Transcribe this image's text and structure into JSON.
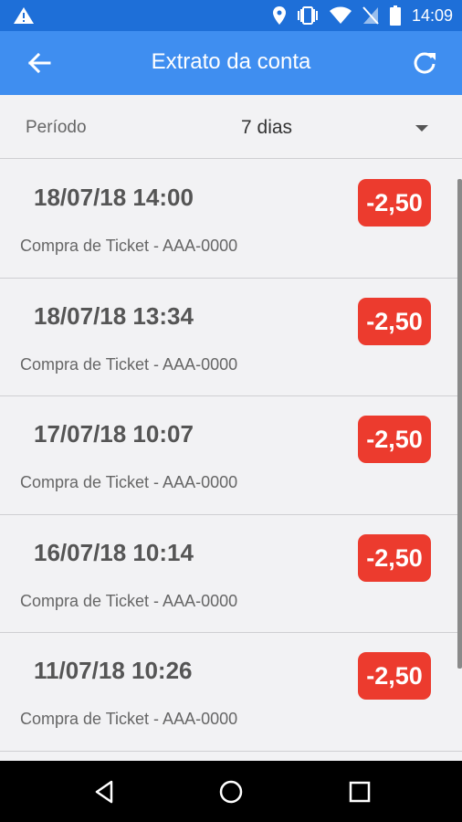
{
  "status_bar": {
    "time": "14:09",
    "icons": [
      "warning-icon",
      "location-icon",
      "vibrate-icon",
      "wifi-icon",
      "no-sim-icon",
      "battery-icon"
    ]
  },
  "app_bar": {
    "title": "Extrato da conta",
    "back_icon": "arrow-back-icon",
    "refresh_icon": "refresh-icon"
  },
  "period": {
    "label": "Período",
    "selected": "7 dias"
  },
  "transactions": [
    {
      "date": "18/07/18 14:00",
      "description": "Compra de Ticket - AAA-0000",
      "amount": "-2,50"
    },
    {
      "date": "18/07/18 13:34",
      "description": "Compra de Ticket - AAA-0000",
      "amount": "-2,50"
    },
    {
      "date": "17/07/18 10:07",
      "description": "Compra de Ticket - AAA-0000",
      "amount": "-2,50"
    },
    {
      "date": "16/07/18 10:14",
      "description": "Compra de Ticket - AAA-0000",
      "amount": "-2,50"
    },
    {
      "date": "11/07/18 10:26",
      "description": "Compra de Ticket - AAA-0000",
      "amount": "-2,50"
    }
  ],
  "colors": {
    "status_bar": "#1e6fd8",
    "app_bar": "#3f8ef0",
    "amount_badge": "#ec3b2e",
    "background": "#f2f2f4"
  }
}
